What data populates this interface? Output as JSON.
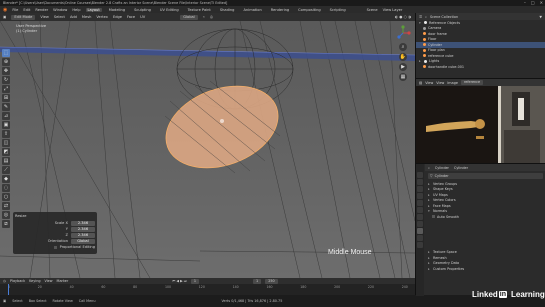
{
  "app": {
    "title": "Blender* [C:\\Users\\User\\Documents\\Online Courses\\Blender 2.8 Crafts an Interior Scene\\Blender Scene File\\Interior Scene\\TI Edited]",
    "window_buttons": [
      "–",
      "□",
      "✕"
    ]
  },
  "menubar": {
    "menus": [
      "File",
      "Edit",
      "Render",
      "Window",
      "Help"
    ],
    "workspaces": [
      "Layout",
      "Modeling",
      "Sculpting",
      "UV Editing",
      "Texture Paint",
      "Shading",
      "Animation",
      "Rendering",
      "Compositing",
      "Scripting"
    ],
    "active_workspace": "Layout",
    "scene": "Scene",
    "view_layer": "View Layer"
  },
  "viewport": {
    "mode": "Edit Mode",
    "menus": [
      "View",
      "Select",
      "Add",
      "Mesh",
      "Vertex",
      "Edge",
      "Face",
      "UV"
    ],
    "overlay_lines": [
      "User Perspective",
      "(1) Cylinder"
    ],
    "transform_orientation": "Global",
    "tools": [
      "select-icon",
      "cursor-icon",
      "move-icon",
      "rotate-icon",
      "scale-icon",
      "transform-icon",
      "annotate-icon",
      "measure-icon",
      "extrude-icon",
      "inset-icon",
      "bevel-icon",
      "loopcut-icon",
      "knife-icon",
      "polybuild-icon",
      "spin-icon",
      "smooth-icon",
      "edgeslide-icon",
      "shrink-icon",
      "shear-icon",
      "rip-icon"
    ],
    "middle_mouse_label": "Middle Mouse"
  },
  "operator_panel": {
    "title": "Resize",
    "props": [
      {
        "label": "Scale X",
        "value": "2.346"
      },
      {
        "label": "Y",
        "value": "2.346"
      },
      {
        "label": "Z",
        "value": "2.346"
      }
    ],
    "orientation_label": "Orientation",
    "orientation_value": "Global",
    "proportional_label": "Proportional Editing"
  },
  "timeline": {
    "menus": [
      "Playback",
      "Keying",
      "View",
      "Marker"
    ],
    "frame": "1",
    "start": "1",
    "end": "250",
    "ticks": [
      "0",
      "20",
      "40",
      "60",
      "80",
      "100",
      "120",
      "140",
      "160",
      "180",
      "200",
      "220",
      "240"
    ]
  },
  "statusbar": {
    "items": [
      "Select",
      "Box Select",
      "Rotate View",
      "Call Menu"
    ],
    "version": "Verts 0/1,468 | Tris 16,876 | 2.80.75"
  },
  "outliner": {
    "title": "Scene Collection",
    "items": [
      {
        "label": "Reference Objects",
        "color": "#e8e8e8",
        "selected": false
      },
      {
        "label": "Camera",
        "color": "#9e9e9e",
        "selected": false
      },
      {
        "label": "door frame",
        "color": "#ff9c4a",
        "selected": false
      },
      {
        "label": "Floor",
        "color": "#ff9c4a",
        "selected": false
      },
      {
        "label": "Cylinder",
        "color": "#ff9c4a",
        "selected": true
      },
      {
        "label": "Floor plan",
        "color": "#ff9c4a",
        "selected": false
      },
      {
        "label": "reference cube",
        "color": "#ff9c4a",
        "selected": false
      },
      {
        "label": "Lights",
        "color": "#e8e8e8",
        "selected": false
      },
      {
        "label": "doorhandle cube.001",
        "color": "#ff9c4a",
        "selected": false
      }
    ]
  },
  "image_editor": {
    "menus": [
      "View",
      "View",
      "Image"
    ],
    "image_name": "reference"
  },
  "properties": {
    "object_name": "Cylinder",
    "tabs": [
      "Cylinder",
      "Cylinder"
    ],
    "sections": [
      "Vertex Groups",
      "Shape Keys",
      "UV Maps",
      "Vertex Colors",
      "Face Maps",
      "Normals"
    ],
    "subsection": "Auto Smooth",
    "sections2": [
      "Texture Space",
      "Remesh",
      "Geometry Data",
      "Custom Properties"
    ]
  },
  "watermark": {
    "prefix": "Linked",
    "in": "in",
    "suffix": "Learning"
  }
}
